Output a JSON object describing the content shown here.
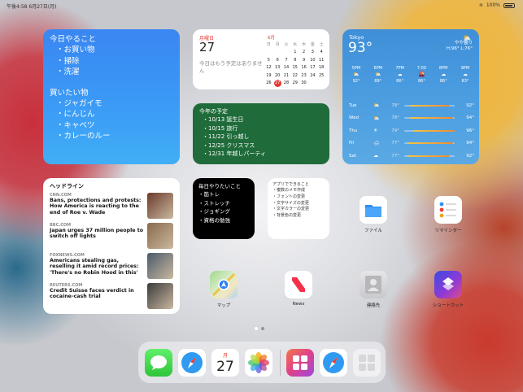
{
  "status_bar": {
    "time": "午後4:58",
    "date": "6月27日(月)",
    "battery": "100%"
  },
  "todo_widget": {
    "title": "今日やること",
    "items": [
      "・お買い物",
      "・掃除",
      "・洗濯"
    ],
    "title2": "買いたい物",
    "items2": [
      "・ジャガイモ",
      "・にんじん",
      "・キャベツ",
      "・カレーのルー"
    ]
  },
  "calendar_widget": {
    "weekday": "月曜日",
    "day": "27",
    "message": "今日はもう予定はありません",
    "month": "6月",
    "weekday_headers": [
      "日",
      "月",
      "火",
      "水",
      "木",
      "金",
      "土"
    ],
    "weeks": [
      [
        "",
        "",
        "",
        "1",
        "2",
        "3",
        "4"
      ],
      [
        "5",
        "6",
        "7",
        "8",
        "9",
        "10",
        "11"
      ],
      [
        "12",
        "13",
        "14",
        "15",
        "16",
        "17",
        "18"
      ],
      [
        "19",
        "20",
        "21",
        "22",
        "23",
        "24",
        "25"
      ],
      [
        "26",
        "27",
        "28",
        "29",
        "30",
        "",
        ""
      ]
    ],
    "today": "27"
  },
  "plans_widget": {
    "title": "今年の予定",
    "items": [
      "・10/13 誕生日",
      "・10/15 旅行",
      "・11/22 引っ越し",
      "・12/25 クリスマス",
      "・12/31 年越しパーティ"
    ]
  },
  "weather_widget": {
    "city": "Tokyo",
    "temp": "93°",
    "condition": "やや曇り",
    "hi_lo": "H:96° L:76°",
    "hourly": [
      {
        "time": "5PM",
        "icon": "cloud-sun-icon",
        "temp": "92°"
      },
      {
        "time": "6PM",
        "icon": "cloud-sun-icon",
        "temp": "89°"
      },
      {
        "time": "7PM",
        "icon": "cloud-icon",
        "temp": "86°"
      },
      {
        "time": "7:00",
        "icon": "sunset-icon",
        "temp": "86°"
      },
      {
        "time": "8PM",
        "icon": "cloud-icon",
        "temp": "86°"
      },
      {
        "time": "9PM",
        "icon": "cloud-moon-icon",
        "temp": "83°"
      }
    ],
    "daily": [
      {
        "day": "Tue",
        "icon": "cloud-sun-icon",
        "lo": "78°",
        "hi": "92°",
        "bar_start": 0.12,
        "bar_end": 0.9
      },
      {
        "day": "Wed",
        "icon": "cloud-sun-icon",
        "lo": "78°",
        "hi": "94°",
        "bar_start": 0.12,
        "bar_end": 0.96
      },
      {
        "day": "Thu",
        "icon": "sun-icon",
        "lo": "79°",
        "hi": "96°",
        "bar_start": 0.18,
        "bar_end": 1.0
      },
      {
        "day": "Fri",
        "icon": "cloud-rain-icon",
        "lo": "77°",
        "hi": "94°",
        "bar_start": 0.06,
        "bar_end": 0.96
      },
      {
        "day": "Sat",
        "icon": "cloud-icon",
        "lo": "77°",
        "hi": "92°",
        "bar_start": 0.06,
        "bar_end": 0.9
      }
    ]
  },
  "news_widget": {
    "title": "ヘッドライン",
    "stories": [
      {
        "source": "CNN.COM",
        "headline": "Bans, protections and protests: How America is reacting to the end of Roe v. Wade",
        "thumb_color": "#6b3a2a"
      },
      {
        "source": "BBC.COM",
        "headline": "Japan urges 37 million people to switch off lights",
        "thumb_color": "#8a6a4a"
      },
      {
        "source": "FOXNEWS.COM",
        "headline": "Americans stealing gas, reselling it amid record prices: 'There's no Robin Hood in this'",
        "thumb_color": "#4a5a6a"
      },
      {
        "source": "REUTERS.COM",
        "headline": "Credit Suisse faces verdict in cocaine-cash trial",
        "thumb_color": "#3a3a3a"
      }
    ]
  },
  "wish_widget": {
    "title": "毎日やりたいこと",
    "items": [
      "・筋トレ",
      "・ストレッチ",
      "・ジョギング",
      "・資格の勉強"
    ]
  },
  "memo_widget": {
    "title": "アプリでできること",
    "items": [
      "・複数のメモ作成",
      "・フォントの変更",
      "・文字サイズの変更",
      "・文字カラーの変更",
      "・背景色の変更"
    ]
  },
  "apps": {
    "files": "ファイル",
    "reminders": "リマインダー",
    "maps": "マップ",
    "news": "News",
    "contacts": "連絡先",
    "shortcuts": "ショートカット"
  },
  "dock": {
    "calendar_weekday": "月",
    "calendar_day": "27"
  }
}
